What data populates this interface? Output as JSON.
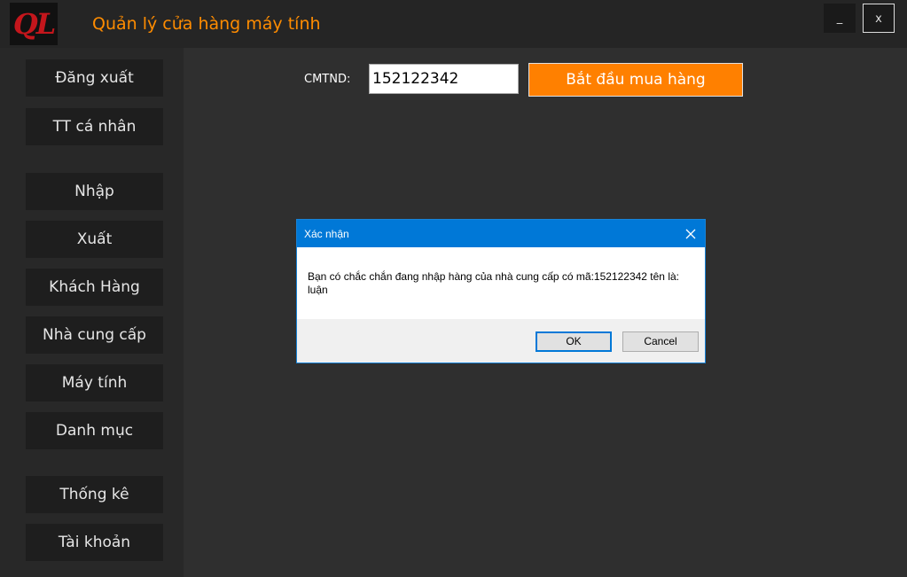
{
  "app": {
    "logo_text": "QL",
    "title": "Quản lý cửa hàng máy tính",
    "minimize_label": "_",
    "close_label": "x"
  },
  "sidebar": {
    "items": [
      {
        "label": "Đăng xuất"
      },
      {
        "label": "TT cá nhân"
      },
      {
        "label": "Nhập"
      },
      {
        "label": "Xuất"
      },
      {
        "label": "Khách Hàng"
      },
      {
        "label": "Nhà cung cấp"
      },
      {
        "label": "Máy tính"
      },
      {
        "label": "Danh mục"
      },
      {
        "label": "Thống kê"
      },
      {
        "label": "Tài khoản"
      }
    ]
  },
  "main": {
    "cmtnd_label": "CMTND:",
    "cmtnd_value": "152122342",
    "start_button": "Bắt đầu mua hàng"
  },
  "dialog": {
    "title": "Xác nhận",
    "message": "Bạn có chắc chắn đang nhập hàng của nhà cung cấp có mã:152122342 tên là: luận",
    "ok_label": "OK",
    "cancel_label": "Cancel"
  },
  "colors": {
    "accent_orange": "#ff8000",
    "title_orange": "#ff8c00",
    "dialog_blue": "#0078d7",
    "logo_red": "#c4161c"
  },
  "icons": {
    "dialog_close": "close-icon"
  }
}
